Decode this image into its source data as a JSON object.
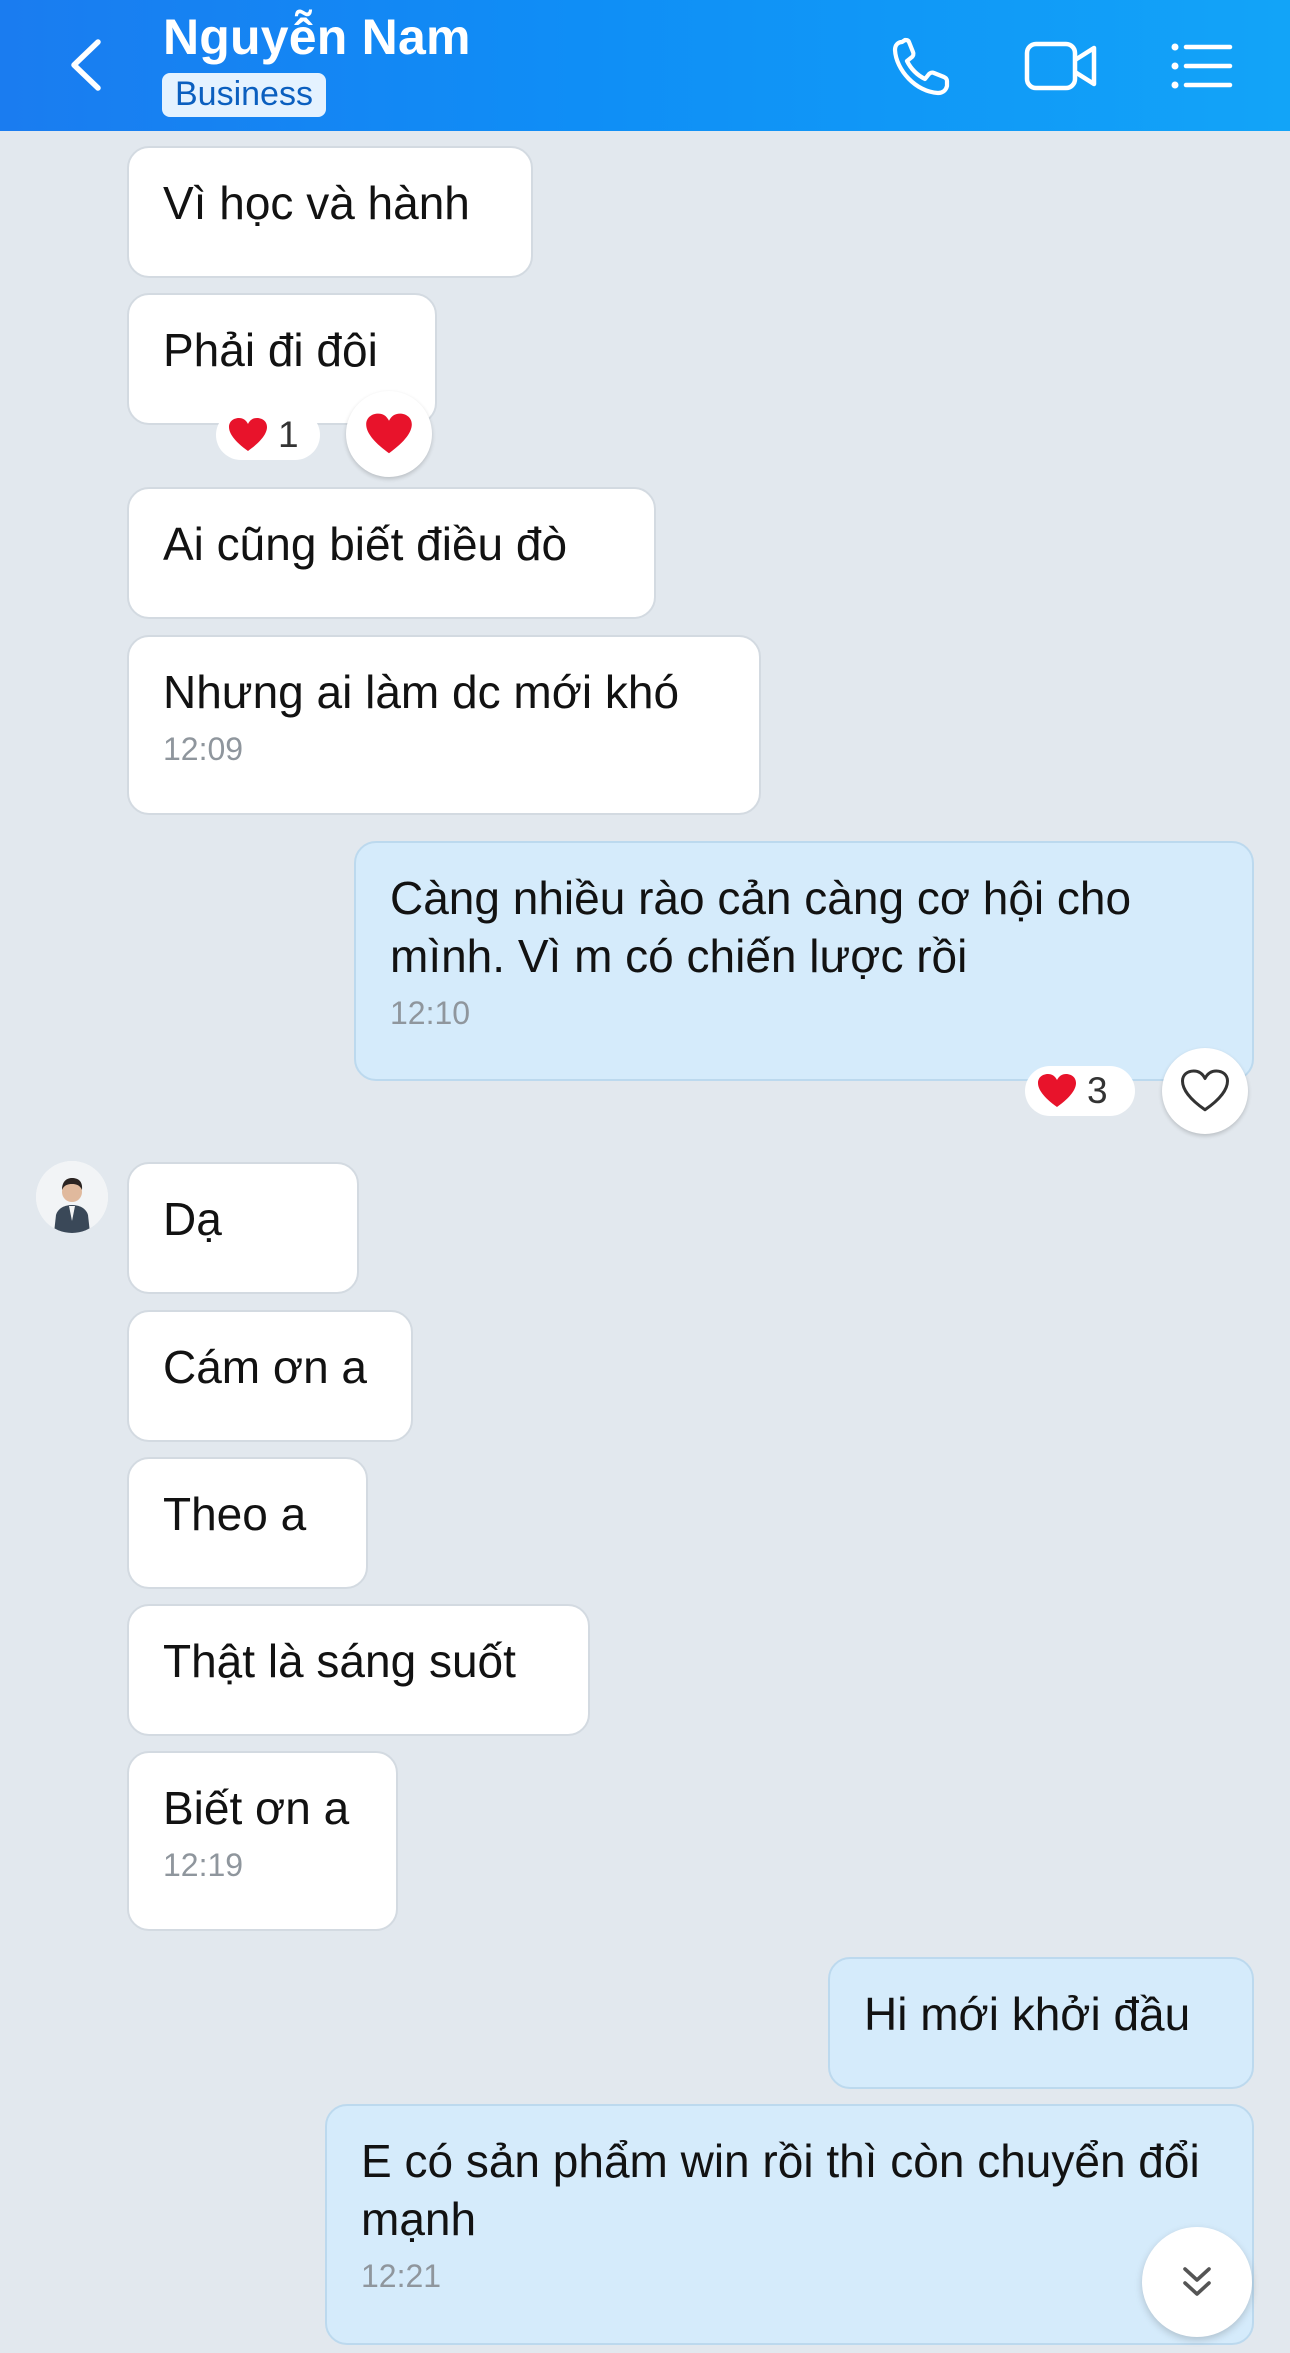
{
  "header": {
    "contact_name": "Nguyễn Nam",
    "badge": "Business",
    "background": "#1a8cf4"
  },
  "icons": {
    "back": "chevron-left-icon",
    "call": "phone-icon",
    "video": "video-camera-icon",
    "menu": "list-menu-icon",
    "scroll_down": "double-chevron-down-icon"
  },
  "messages": [
    {
      "dir": "in",
      "text": "Vì học và hành"
    },
    {
      "dir": "in",
      "text": "Phải đi đôi",
      "reaction": {
        "emoji": "heart",
        "count": "1"
      }
    },
    {
      "dir": "in",
      "text": "Ai cũng biết điều đò"
    },
    {
      "dir": "in",
      "text": "Nhưng ai làm dc mới khó",
      "time": "12:09"
    },
    {
      "dir": "out",
      "text": "Càng nhiều rào cản càng cơ hội cho mình. Vì m có chiến lược rồi",
      "time": "12:10",
      "reaction": {
        "emoji": "heart",
        "count": "3"
      }
    },
    {
      "dir": "in",
      "text": "Dạ"
    },
    {
      "dir": "in",
      "text": "Cám ơn a"
    },
    {
      "dir": "in",
      "text": "Theo a"
    },
    {
      "dir": "in",
      "text": "Thật là sáng suốt"
    },
    {
      "dir": "in",
      "text": "Biết ơn a",
      "time": "12:19"
    },
    {
      "dir": "out",
      "text": "Hi mới khởi đầu"
    },
    {
      "dir": "out",
      "text": "E có sản phẩm win rồi thì còn chuyển đổi mạnh",
      "time": "12:21"
    }
  ],
  "colors": {
    "incoming_bubble": "#ffffff",
    "outgoing_bubble": "#d5ebfb",
    "chat_background": "#e2e8ee",
    "heart": "#e8132b"
  }
}
